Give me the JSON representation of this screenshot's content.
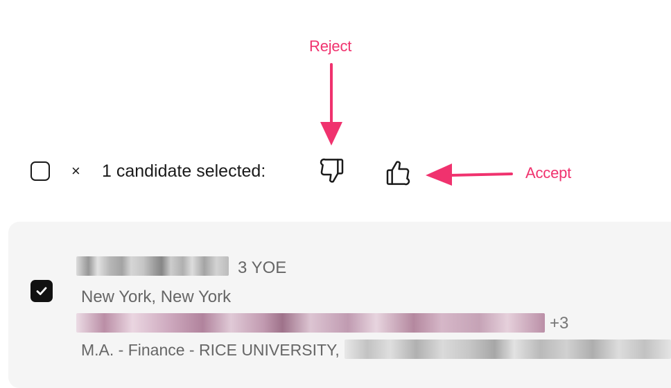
{
  "annotations": {
    "reject": "Reject",
    "accept": "Accept",
    "color": "#f0326e"
  },
  "toolbar": {
    "selection_label": "1 candidate selected:",
    "clear_symbol": "×",
    "reject_icon": "thumbs-down-icon",
    "accept_icon": "thumbs-up-icon"
  },
  "candidate": {
    "experience": "3 YOE",
    "location": "New York, New York",
    "extra_count": "+3",
    "education": "M.A. - Finance - RICE UNIVERSITY,",
    "selected": true
  }
}
